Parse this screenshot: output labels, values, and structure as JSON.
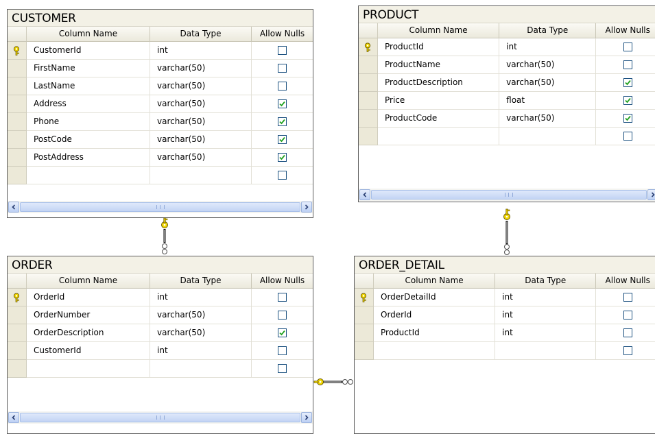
{
  "tables": {
    "customer": {
      "title": "CUSTOMER",
      "headers": {
        "column_name": "Column Name",
        "data_type": "Data Type",
        "allow_nulls": "Allow Nulls"
      },
      "rows": [
        {
          "name": "CustomerId",
          "type": "int",
          "nulls": false,
          "key": true
        },
        {
          "name": "FirstName",
          "type": "varchar(50)",
          "nulls": false,
          "key": false
        },
        {
          "name": "LastName",
          "type": "varchar(50)",
          "nulls": false,
          "key": false
        },
        {
          "name": "Address",
          "type": "varchar(50)",
          "nulls": true,
          "key": false
        },
        {
          "name": "Phone",
          "type": "varchar(50)",
          "nulls": true,
          "key": false
        },
        {
          "name": "PostCode",
          "type": "varchar(50)",
          "nulls": true,
          "key": false
        },
        {
          "name": "PostAddress",
          "type": "varchar(50)",
          "nulls": true,
          "key": false
        },
        {
          "name": "",
          "type": "",
          "nulls": false,
          "key": false
        }
      ]
    },
    "product": {
      "title": "PRODUCT",
      "headers": {
        "column_name": "Column Name",
        "data_type": "Data Type",
        "allow_nulls": "Allow Nulls"
      },
      "rows": [
        {
          "name": "ProductId",
          "type": "int",
          "nulls": false,
          "key": true
        },
        {
          "name": "ProductName",
          "type": "varchar(50)",
          "nulls": false,
          "key": false
        },
        {
          "name": "ProductDescription",
          "type": "varchar(50)",
          "nulls": true,
          "key": false
        },
        {
          "name": "Price",
          "type": "float",
          "nulls": true,
          "key": false
        },
        {
          "name": "ProductCode",
          "type": "varchar(50)",
          "nulls": true,
          "key": false
        },
        {
          "name": "",
          "type": "",
          "nulls": false,
          "key": false
        }
      ]
    },
    "order": {
      "title": "ORDER",
      "headers": {
        "column_name": "Column Name",
        "data_type": "Data Type",
        "allow_nulls": "Allow Nulls"
      },
      "rows": [
        {
          "name": "OrderId",
          "type": "int",
          "nulls": false,
          "key": true
        },
        {
          "name": "OrderNumber",
          "type": "varchar(50)",
          "nulls": false,
          "key": false
        },
        {
          "name": "OrderDescription",
          "type": "varchar(50)",
          "nulls": true,
          "key": false
        },
        {
          "name": "CustomerId",
          "type": "int",
          "nulls": false,
          "key": false
        },
        {
          "name": "",
          "type": "",
          "nulls": false,
          "key": false
        }
      ]
    },
    "order_detail": {
      "title": "ORDER_DETAIL",
      "headers": {
        "column_name": "Column Name",
        "data_type": "Data Type",
        "allow_nulls": "Allow Nulls"
      },
      "rows": [
        {
          "name": "OrderDetailId",
          "type": "int",
          "nulls": false,
          "key": true
        },
        {
          "name": "OrderId",
          "type": "int",
          "nulls": false,
          "key": false
        },
        {
          "name": "ProductId",
          "type": "int",
          "nulls": false,
          "key": false
        },
        {
          "name": "",
          "type": "",
          "nulls": false,
          "key": false
        }
      ]
    }
  },
  "icons": {
    "primary_key": "key-icon",
    "checked": "checkmark-icon",
    "scroll_left": "arrow-left-icon",
    "scroll_right": "arrow-right-icon"
  },
  "colors": {
    "key_fill": "#f2d700",
    "check_green": "#21a121",
    "checkbox_border": "#1c5180",
    "title_bg": "#f3f1e6",
    "selector_bg": "#ece9d8"
  }
}
